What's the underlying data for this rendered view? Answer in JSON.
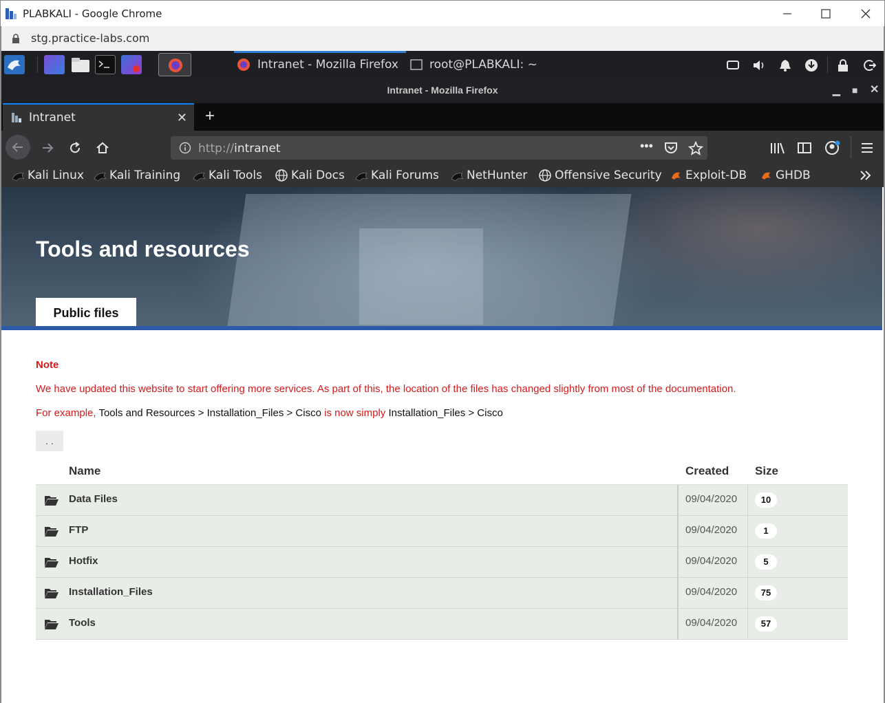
{
  "chrome": {
    "title": "PLABKALI - Google Chrome",
    "address": "stg.practice-labs.com"
  },
  "kali_panel": {
    "tasks": [
      {
        "label": "Intranet - Mozilla Firefox"
      },
      {
        "label": "root@PLABKALI: ~"
      }
    ]
  },
  "firefox": {
    "window_title": "Intranet - Mozilla Firefox",
    "tab_label": "Intranet",
    "url_protocol": "http://",
    "url_host": "intranet",
    "bookmarks": [
      {
        "label": "Kali Linux",
        "icon": "kali-dragon-icon"
      },
      {
        "label": "Kali Training",
        "icon": "kali-dragon-icon"
      },
      {
        "label": "Kali Tools",
        "icon": "kali-dragon-icon"
      },
      {
        "label": "Kali Docs",
        "icon": "globe-icon"
      },
      {
        "label": "Kali Forums",
        "icon": "kali-dragon-icon"
      },
      {
        "label": "NetHunter",
        "icon": "kali-dragon-icon"
      },
      {
        "label": "Offensive Security",
        "icon": "globe-icon"
      },
      {
        "label": "Exploit-DB",
        "icon": "exploit-db-icon"
      },
      {
        "label": "GHDB",
        "icon": "exploit-db-icon"
      }
    ]
  },
  "page": {
    "title": "Tools and resources",
    "tab": "Public files",
    "note_heading": "Note",
    "note_line1": "We have updated this website to start offering more services. As part of this, the location of the files has changed slightly from most of the documentation.",
    "note_line2_prefix": "For example, ",
    "note_line2_path1": "Tools and Resources > Installation_Files > Cisco",
    "note_line2_mid": " is now simply ",
    "note_line2_path2": "Installation_Files > Cisco",
    "up_label": ". .",
    "columns": {
      "name": "Name",
      "created": "Created",
      "size": "Size"
    },
    "files": [
      {
        "name": "Data Files",
        "created": "09/04/2020",
        "size": "10"
      },
      {
        "name": "FTP",
        "created": "09/04/2020",
        "size": "1"
      },
      {
        "name": "Hotfix",
        "created": "09/04/2020",
        "size": "5"
      },
      {
        "name": "Installation_Files",
        "created": "09/04/2020",
        "size": "75"
      },
      {
        "name": "Tools",
        "created": "09/04/2020",
        "size": "57"
      }
    ]
  },
  "colors": {
    "note_red": "#d41a1a",
    "accent_blue": "#2d5aa6",
    "row_bg": "#e9ede7"
  }
}
